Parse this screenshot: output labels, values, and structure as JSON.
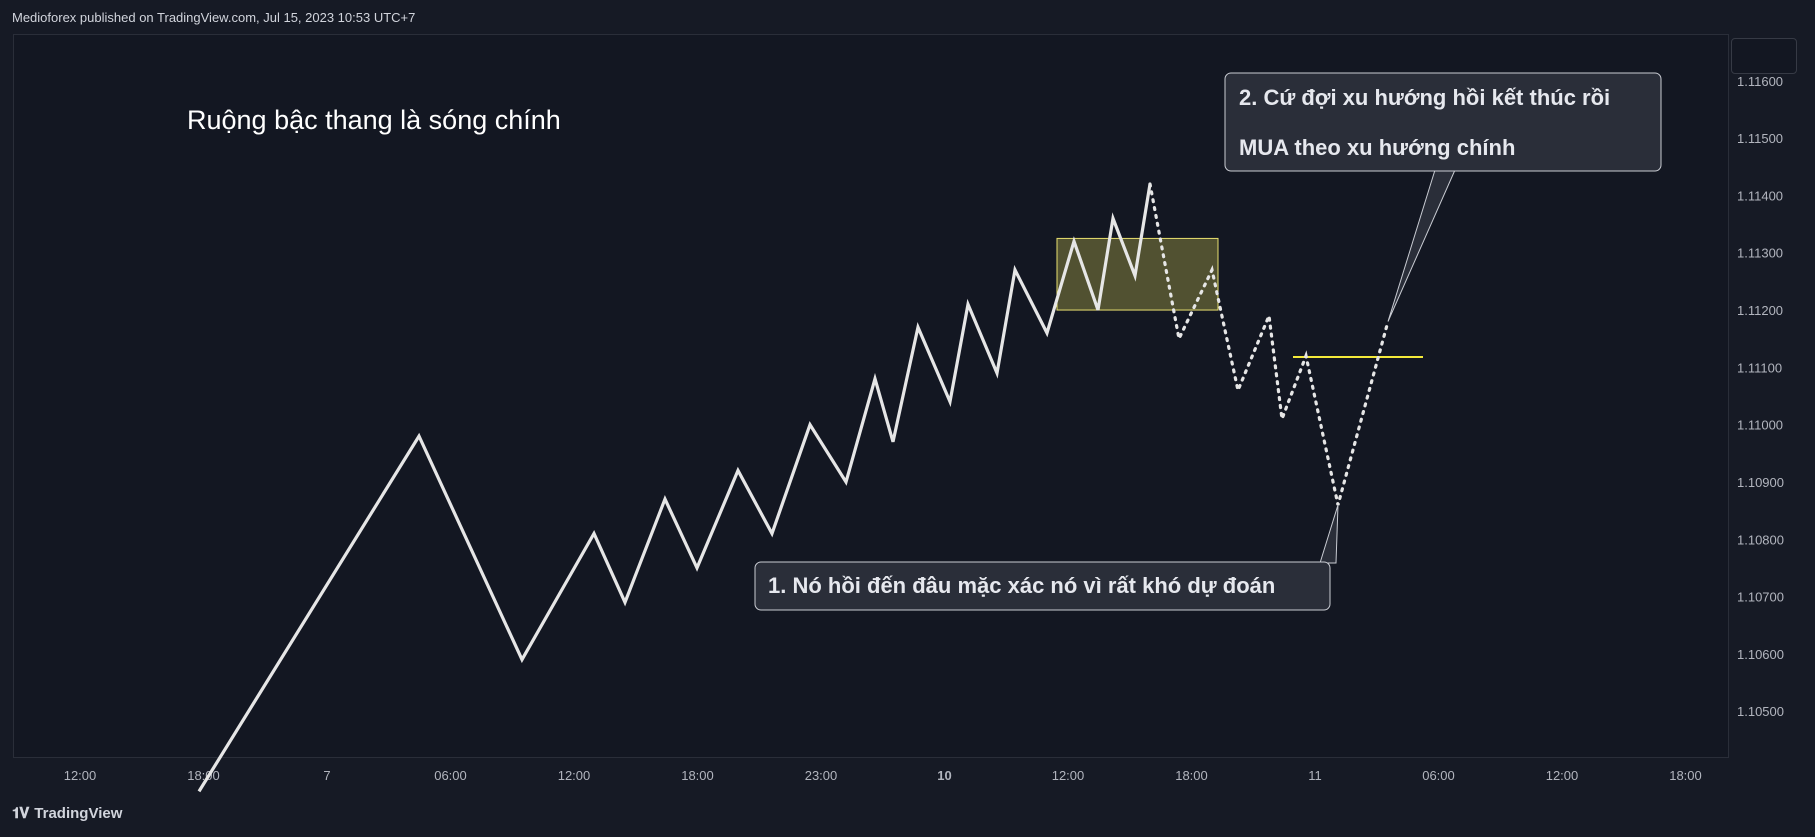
{
  "header": {
    "published": "Medioforex published on TradingView.com, Jul 15, 2023 10:53 UTC+7"
  },
  "footer": {
    "brand": "TradingView",
    "logo_icon": "tradingview-logo-icon"
  },
  "chart_data": {
    "type": "line",
    "title": "Ruộng bậc thang là sóng chính",
    "y_ticks": [
      "1.11600",
      "1.11500",
      "1.11400",
      "1.11300",
      "1.11200",
      "1.11100",
      "1.11000",
      "1.10900",
      "1.10800",
      "1.10700",
      "1.10600",
      "1.10500"
    ],
    "x_ticks": [
      "12:00",
      "18:00",
      "7",
      "06:00",
      "12:00",
      "18:00",
      "23:00",
      "10",
      "12:00",
      "18:00",
      "11",
      "06:00",
      "12:00",
      "18:00"
    ],
    "x_ticks_bold": [
      false,
      false,
      false,
      false,
      false,
      false,
      false,
      true,
      false,
      false,
      false,
      false,
      false,
      false
    ],
    "ylim": [
      1.1042,
      1.1168
    ],
    "series": [
      {
        "style": "solid",
        "color": "#e6e6e6",
        "values": [
          1.1036,
          1.1098,
          1.1059,
          1.1081,
          1.1069,
          1.1087,
          1.1075,
          1.1092,
          1.1081,
          1.11,
          1.109,
          1.1108,
          1.1097,
          1.1117,
          1.1104,
          1.1121,
          1.1109,
          1.1127,
          1.1116,
          1.1132,
          1.112,
          1.1136,
          1.1126,
          1.1142
        ]
      },
      {
        "style": "dotted",
        "color": "#e6e6e6",
        "values": [
          1.1142,
          1.1115,
          1.1127,
          1.1106,
          1.1119,
          1.1101,
          1.1112,
          1.1086,
          1.1118
        ]
      }
    ],
    "annotations": {
      "rectangle": {
        "y_range": [
          1.112,
          1.11325
        ],
        "fill": "#b7b04a",
        "stroke": "#e8e070"
      },
      "horizontal_line": {
        "y": 1.11118,
        "color": "#f4ea3a"
      },
      "callout1": {
        "text": "1. Nó hồi đến đâu mặc xác nó vì rất khó dự đoán"
      },
      "callout2": {
        "line1": "2. Cứ đợi xu hướng hồi kết thúc rồi",
        "line2": "MUA theo xu hướng chính"
      }
    }
  }
}
